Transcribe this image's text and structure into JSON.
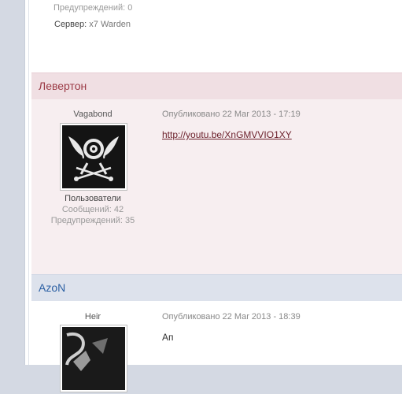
{
  "prev_post": {
    "warnings_label": "Предупреждений:",
    "warnings_value": "0",
    "server_label": "Сервер:",
    "server_value": "x7 Warden"
  },
  "posts": [
    {
      "author": "Левертон",
      "user_title": "Vagabond",
      "group": "Пользователи",
      "posts_label": "Сообщений:",
      "posts_value": "42",
      "warnings_label": "Предупреждений:",
      "warnings_value": "35",
      "posted": "Опубликовано 22 Mar 2013 - 17:19",
      "content_link": "http://youtu.be/XnGMVVIO1XY",
      "avatar_icon": "eye-emblem-icon"
    },
    {
      "author": "AzoN",
      "user_title": "Heir",
      "posted": "Опубликовано 22 Mar 2013 - 18:39",
      "content_text": "Ап",
      "avatar_icon": "dark-emblem-icon"
    }
  ],
  "colors": {
    "author_red": "#9b3a45",
    "author_blue": "#2a5fa3",
    "header_red_bg": "#f0dfe3",
    "header_blue_bg": "#dde2ec",
    "post_bg_pink": "#f7eef0"
  }
}
